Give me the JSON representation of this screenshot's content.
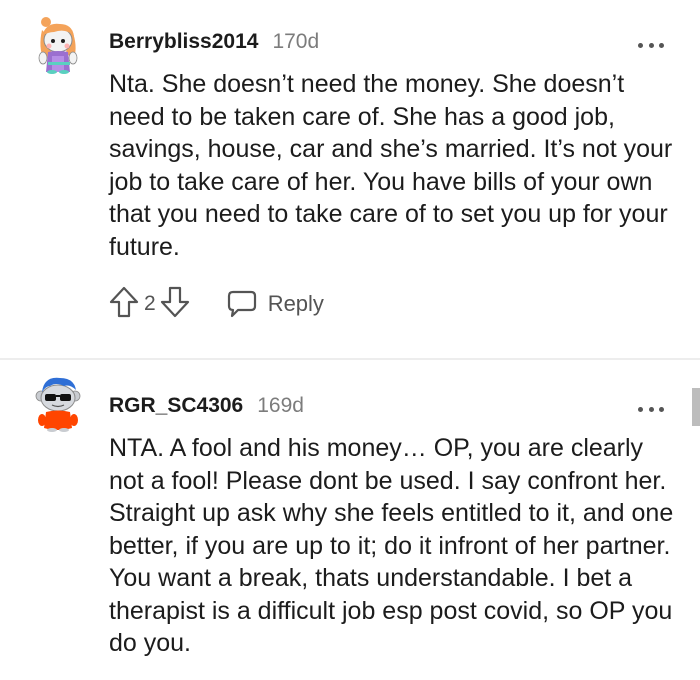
{
  "comments": [
    {
      "username": "Berrybliss2014",
      "age": "170d",
      "body": "Nta. She doesn’t need the money. She doesn’t need to be taken care of. She has a good job, savings, house, car and she’s married. It’s not your job to take care of her. You have bills of your own that you need to take care of to set you up for your future.",
      "vote_count": "2",
      "reply_label": "Reply",
      "avatar": "redhead-avatar"
    },
    {
      "username": "RGR_SC4306",
      "age": "169d",
      "body": "NTA. A fool and his money… OP, you are clearly not a fool! Please dont be used. I say confront her. Straight up ask why she feels entitled to it, and one better, if you are up to it; do it infront of her partner. You want a break, thats understandable. I bet a therapist is a difficult job esp post covid, so OP you do you.",
      "avatar": "snoo-sunglasses-avatar"
    }
  ],
  "icons": {
    "upvote": "upvote-arrow-icon",
    "downvote": "downvote-arrow-icon",
    "reply": "speech-bubble-icon",
    "more": "ellipsis-icon"
  },
  "colors": {
    "text": "#1c1c1c",
    "muted": "#7c7c7c",
    "action": "#545454",
    "avatar1_hair": "#f4a35a",
    "avatar2_hair": "#2f6fd6",
    "avatar2_shirt": "#ff4500"
  }
}
